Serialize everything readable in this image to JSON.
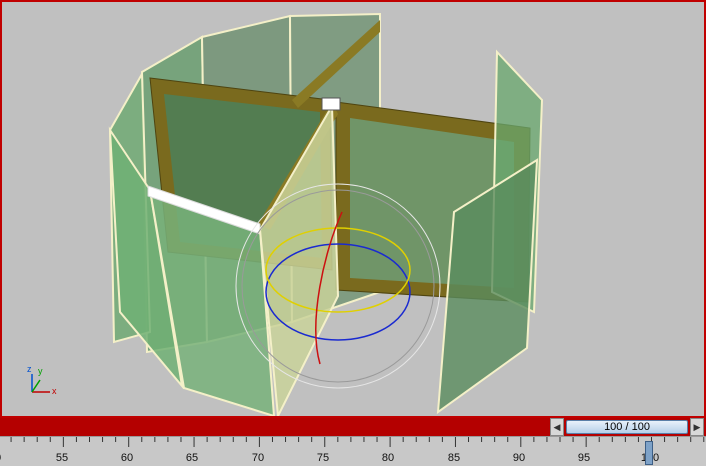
{
  "viewport": {
    "axis_labels": {
      "x": "x",
      "y": "y",
      "z": "z"
    },
    "colors": {
      "glass": "#6aa86e",
      "frame": "#7a6a1e",
      "selection": "#ffffff",
      "border": "#c00000"
    }
  },
  "time_slider": {
    "label": "100 / 100",
    "current_frame": 100,
    "total_frames": 100
  },
  "timeline": {
    "tick_labels": [
      "0",
      "55",
      "60",
      "65",
      "70",
      "75",
      "80",
      "85",
      "90",
      "95",
      "100"
    ]
  }
}
